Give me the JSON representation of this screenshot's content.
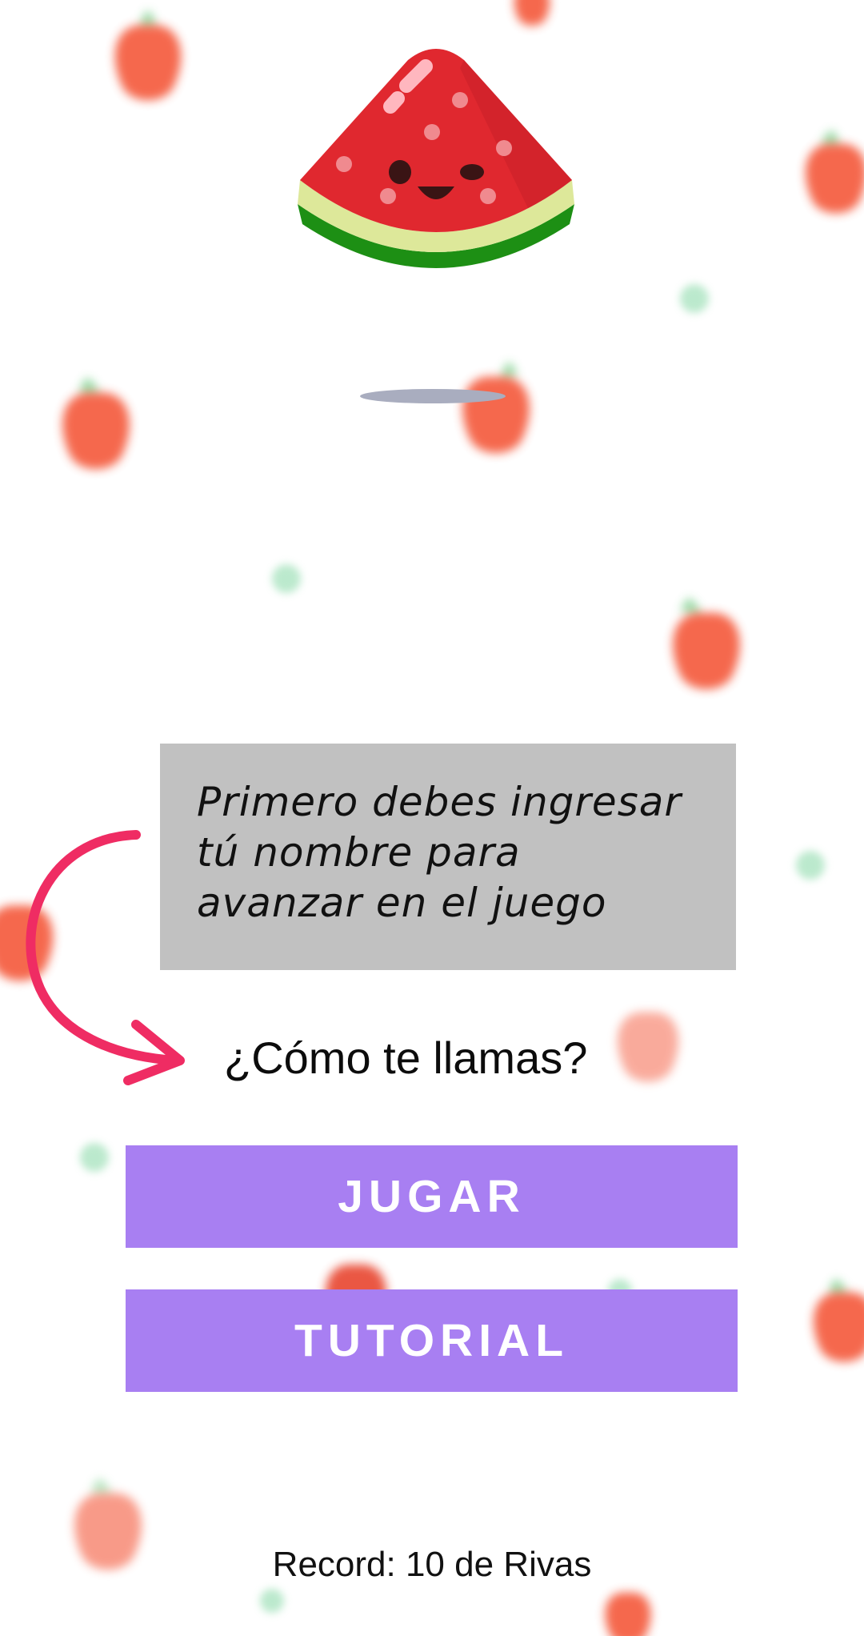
{
  "hint": {
    "text": "Primero debes ingresar\ntú nombre para\navanzar en el juego"
  },
  "name_prompt": {
    "label": "¿Cómo te llamas?"
  },
  "buttons": {
    "play_label": "JUGAR",
    "tutorial_label": "TUTORIAL"
  },
  "record": {
    "text": "Record: 10 de Rivas"
  },
  "icons": {
    "mascot": "watermelon-mascot-icon",
    "arrow": "curved-arrow-icon",
    "background": "strawberry-icon"
  },
  "colors": {
    "button_bg": "#a87ff2",
    "hint_box_bg": "#c1c1c1",
    "arrow": "#ef2c63",
    "watermelon_flesh": "#e0282f",
    "watermelon_rind": "#1d8f14"
  }
}
